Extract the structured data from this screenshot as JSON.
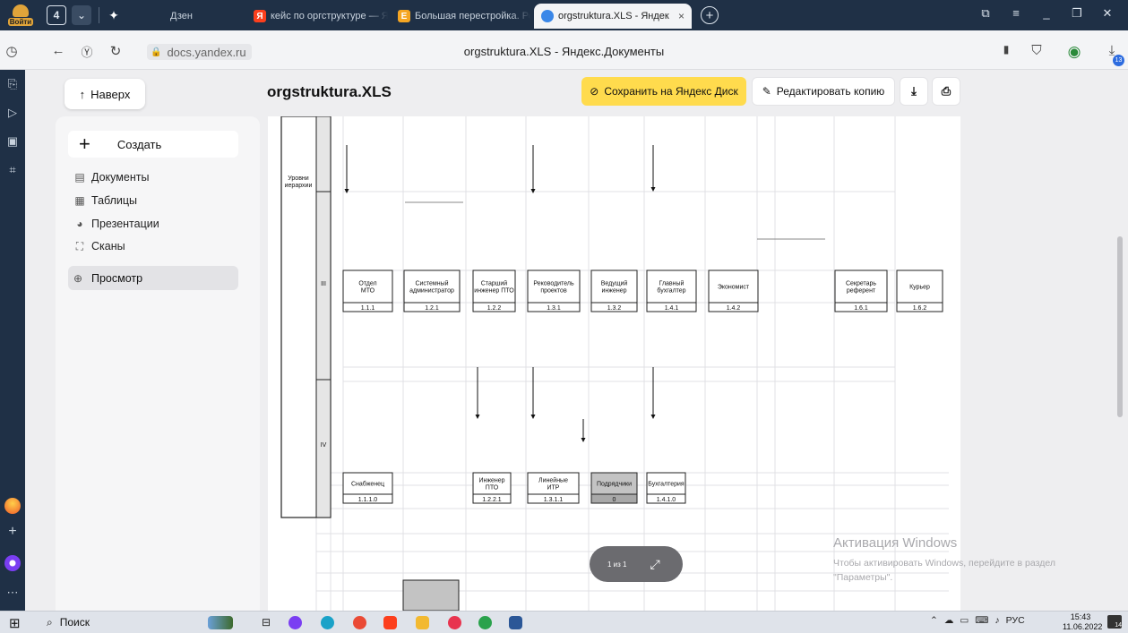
{
  "browser": {
    "login_label": "Войти",
    "tab_count": "4",
    "tabs": [
      {
        "title": "Дзен"
      },
      {
        "title": "кейс по оргструктуре — Я",
        "icon_letter": "Я"
      },
      {
        "title": "Большая перестройка. Ре",
        "icon_letter": "Е"
      },
      {
        "title": "orgstruktura.XLS - Яндек",
        "close": "×"
      }
    ],
    "url": "docs.yandex.ru",
    "page_title": "orgstruktura.XLS - Яндекс.Документы",
    "download_count": "13",
    "colors": {
      "chrome": "#1f3046",
      "accent_yellow": "#ffdb4d",
      "yandex_red": "#fc3f1d"
    }
  },
  "toolbar": {
    "up_label": "Наверх",
    "doc_title": "orgstruktura.XLS",
    "save_label": "Сохранить на Яндекс Диск",
    "edit_label": "Редактировать копию"
  },
  "sidebar": {
    "create_label": "Создать",
    "items": [
      {
        "label": "Документы",
        "icon": "document-icon"
      },
      {
        "label": "Таблицы",
        "icon": "table-icon"
      },
      {
        "label": "Презентации",
        "icon": "presentation-icon"
      },
      {
        "label": "Сканы",
        "icon": "scan-icon"
      },
      {
        "label": "Просмотр",
        "icon": "globe-icon",
        "active": true
      }
    ]
  },
  "sheet": {
    "levels_label": "Уровни иерархии",
    "level_iii": "III",
    "level_iv": "IV",
    "row3": [
      {
        "title": "Отдел МТО",
        "code": "1.1.1"
      },
      {
        "title": "Системный администратор",
        "code": "1.2.1"
      },
      {
        "title": "Старший инженер ПТО",
        "code": "1.2.2"
      },
      {
        "title": "Реководитель проектов",
        "code": "1.3.1"
      },
      {
        "title": "Ведущий инженер",
        "code": "1.3.2"
      },
      {
        "title": "Главный бухгалтер",
        "code": "1.4.1"
      },
      {
        "title": "Экономист",
        "code": "1.4.2"
      },
      {
        "title": "Секретарь референт",
        "code": "1.6.1"
      },
      {
        "title": "Курьер",
        "code": "1.6.2"
      }
    ],
    "row4": [
      {
        "title": "Снабженец",
        "code": "1.1.1.0"
      },
      {
        "title": "Инженер ПТО",
        "code": "1.2.2.1"
      },
      {
        "title": "Линейные ИТР",
        "code": "1.3.1.1"
      },
      {
        "title": "Подрядчики",
        "code": "0",
        "shaded": true
      },
      {
        "title": "Бухгалтерия",
        "code": "1.4.1.0"
      }
    ]
  },
  "pager": {
    "label": "1 из 1"
  },
  "activation": {
    "title": "Активация Windows",
    "subtitle": "Чтобы активировать Windows, перейдите в раздел \"Параметры\"."
  },
  "taskbar": {
    "search_label": "Поиск",
    "lang": "РУС",
    "time": "15:43",
    "date": "11.06.2022",
    "notifications": "14"
  }
}
